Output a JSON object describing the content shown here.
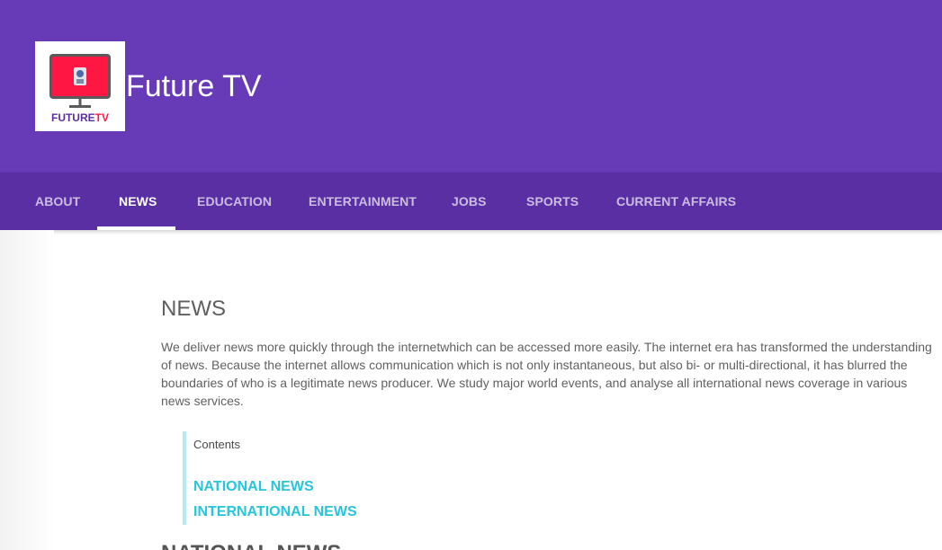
{
  "header": {
    "logo_text": "FUTURETV",
    "title": "Future TV"
  },
  "nav": {
    "tabs": [
      {
        "label": "ABOUT",
        "active": false
      },
      {
        "label": "NEWS",
        "active": true
      },
      {
        "label": "EDUCATION",
        "active": false
      },
      {
        "label": "ENTERTAINMENT",
        "active": false
      },
      {
        "label": "JOBS",
        "active": false
      },
      {
        "label": "SPORTS",
        "active": false
      },
      {
        "label": "CURRENT AFFAIRS",
        "active": false
      }
    ]
  },
  "main": {
    "heading": "NEWS",
    "intro": "We deliver news more quickly through the internetwhich can be accessed more easily. The internet era has transformed the understanding of news. Because the internet allows communication which is not only instantaneous, but also bi- or multi-directional, it has blurred the boundaries of who is a legitimate news producer. We study major world events, and analyse all international news coverage in various news services.",
    "toc": {
      "title": "Contents",
      "links": [
        "NATIONAL NEWS",
        "INTERNATIONAL NEWS"
      ]
    },
    "section_heading": "NATIONAL NEWS"
  },
  "colors": {
    "header_bg": "#673ab7",
    "nav_bg": "#5a2fa3",
    "link": "#26c6da",
    "toc_border": "#b2ebf2",
    "logo_red": "#ff1744"
  }
}
